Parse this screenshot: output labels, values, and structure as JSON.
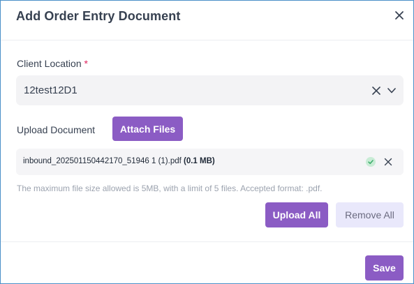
{
  "modal": {
    "title": "Add Order Entry Document"
  },
  "client_location": {
    "label": "Client Location",
    "required_mark": "*",
    "value": "12test12D1"
  },
  "upload": {
    "label": "Upload Document",
    "attach_label": "Attach Files",
    "files": [
      {
        "name": "inbound_202501150442170_51946 1 (1).pdf",
        "size": "(0.1 MB)",
        "status": "uploaded"
      }
    ],
    "hint": "The maximum file size allowed is 5MB, with a limit of 5 files. Accepted format: .pdf.",
    "upload_all_label": "Upload All",
    "remove_all_label": "Remove All"
  },
  "footer": {
    "save_label": "Save"
  },
  "colors": {
    "primary": "#8b5cc4",
    "secondary_bg": "#e9e8fb",
    "success": "#5cc48b",
    "required": "#e0245e"
  }
}
